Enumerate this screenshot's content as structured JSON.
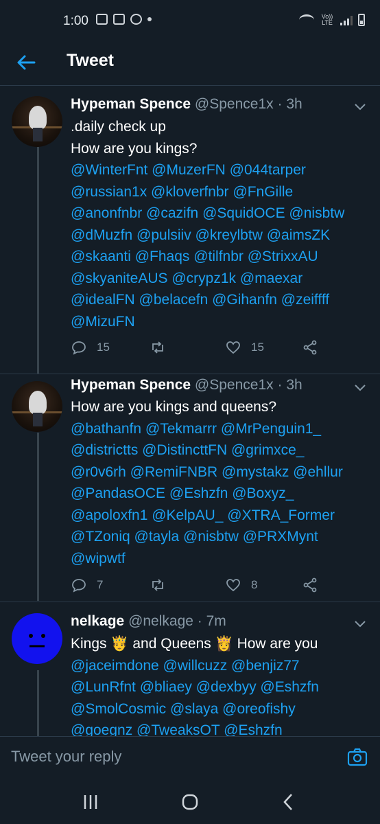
{
  "status": {
    "time": "1:00",
    "lte_label": "Vo)) LTE"
  },
  "header": {
    "title": "Tweet",
    "back_icon": "arrow-left-icon"
  },
  "colors": {
    "background": "#141d26",
    "accent": "#1da1f2",
    "muted": "#8899a6",
    "divider": "#2b3a49"
  },
  "tweets": [
    {
      "name": "Hypeman Spence",
      "handle": "@Spence1x",
      "time": "· 3h",
      "lines": [
        {
          "text": ".daily check up"
        },
        {
          "text": "How are you kings?"
        },
        {
          "mentions": "@WinterFnt @MuzerFN @044tarper"
        },
        {
          "mentions": "@russian1x @kloverfnbr @FnGille"
        },
        {
          "mentions": "@anonfnbr @cazifn  @SquidOCE @nisbtw"
        },
        {
          "mentions": "@dMuzfn @pulsiiv @kreylbtw @aimsZK"
        },
        {
          "mentions": "@skaanti @Fhaqs @tilfnbr @StrixxAU"
        },
        {
          "mentions": "@skyaniteAUS @crypz1k @maexar"
        },
        {
          "mentions": "@idealFN @belacefn @Gihanfn @zeiffff"
        },
        {
          "mentions": "@MizuFN"
        }
      ],
      "replies": "15",
      "likes": "15"
    },
    {
      "name": "Hypeman Spence",
      "handle": "@Spence1x",
      "time": "· 3h",
      "lines": [
        {
          "text": "How are you kings and queens?"
        },
        {
          "mentions": "@bathanfn @Tekmarrr @MrPenguin1_"
        },
        {
          "mentions": "@districtts @DistincttFN @grimxce_"
        },
        {
          "mentions": "@r0v6rh @RemiFNBR @mystakz @ehllur"
        },
        {
          "mentions": "@PandasOCE @Eshzfn @Boxyz_"
        },
        {
          "mentions": "@apoloxfn1 @KelpAU_ @XTRA_Former"
        },
        {
          "mentions": "@TZoniq @tayla @nisbtw @PRXMynt"
        },
        {
          "mentions": "@wipwtf"
        }
      ],
      "replies": "7",
      "likes": "8"
    },
    {
      "name": "nelkage",
      "handle": "@nelkage",
      "time": "· 7m",
      "lines": [
        {
          "text": "Kings 🤴  and Queens 👸  How are you"
        },
        {
          "mentions": "@jaceimdone @willcuzz @benjiz77"
        },
        {
          "mentions": "@LunRfnt @bliaey @dexbyy @Eshzfn"
        },
        {
          "mentions": "@SmolCosmic @slaya @oreofishy"
        },
        {
          "mentions": "@goegnz @TweaksOT @Eshzfn"
        }
      ]
    }
  ],
  "reply": {
    "placeholder": "Tweet your reply"
  }
}
